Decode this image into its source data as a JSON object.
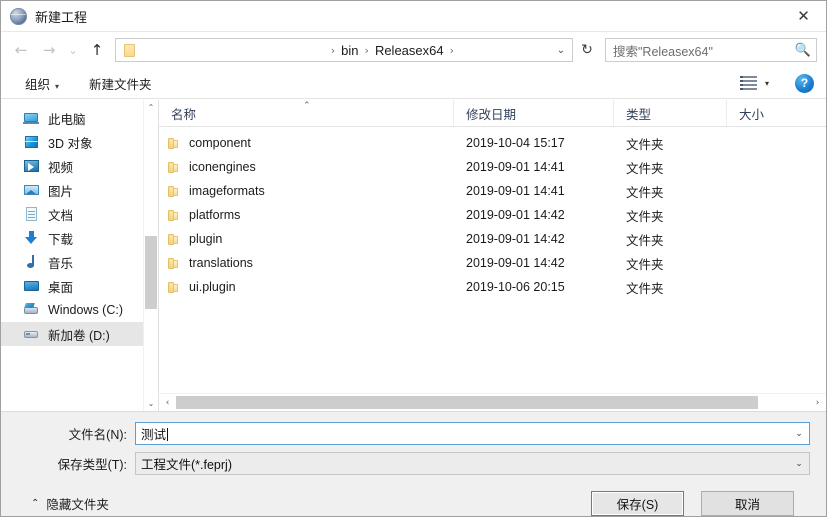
{
  "window": {
    "title": "新建工程",
    "icon": "globe-icon",
    "close_label": "✕"
  },
  "nav": {
    "back": "←",
    "forward": "→",
    "recent": "⌄",
    "up": "↑",
    "breadcrumbs": [
      "bin",
      "Releasex64"
    ],
    "separator": "›",
    "dropdown": "⌄",
    "refresh": "↻"
  },
  "search": {
    "placeholder": "搜索\"Releasex64\"",
    "icon": "search-icon"
  },
  "toolbar": {
    "organize_label": "组织",
    "organize_caret": "▾",
    "new_folder_label": "新建文件夹",
    "view_caret": "▾",
    "help_label": "?"
  },
  "sidebar": {
    "items": [
      {
        "label": "此电脑",
        "icon": "computer-icon",
        "selected": false
      },
      {
        "label": "3D 对象",
        "icon": "3d-objects-icon",
        "selected": false
      },
      {
        "label": "视频",
        "icon": "videos-icon",
        "selected": false
      },
      {
        "label": "图片",
        "icon": "pictures-icon",
        "selected": false
      },
      {
        "label": "文档",
        "icon": "documents-icon",
        "selected": false
      },
      {
        "label": "下载",
        "icon": "downloads-icon",
        "selected": false
      },
      {
        "label": "音乐",
        "icon": "music-icon",
        "selected": false
      },
      {
        "label": "桌面",
        "icon": "desktop-icon",
        "selected": false
      },
      {
        "label": "Windows (C:)",
        "icon": "drive-c-icon",
        "selected": false
      },
      {
        "label": "新加卷 (D:)",
        "icon": "drive-d-icon",
        "selected": true
      }
    ],
    "scroll_up": "⌃",
    "scroll_down": "⌄"
  },
  "filelist": {
    "columns": [
      "名称",
      "修改日期",
      "类型",
      "大小"
    ],
    "sort_indicator": "⌃",
    "rows": [
      {
        "name": "component",
        "date": "2019-10-04 15:17",
        "type": "文件夹",
        "size": ""
      },
      {
        "name": "iconengines",
        "date": "2019-09-01 14:41",
        "type": "文件夹",
        "size": ""
      },
      {
        "name": "imageformats",
        "date": "2019-09-01 14:41",
        "type": "文件夹",
        "size": ""
      },
      {
        "name": "platforms",
        "date": "2019-09-01 14:42",
        "type": "文件夹",
        "size": ""
      },
      {
        "name": "plugin",
        "date": "2019-09-01 14:42",
        "type": "文件夹",
        "size": ""
      },
      {
        "name": "translations",
        "date": "2019-09-01 14:42",
        "type": "文件夹",
        "size": ""
      },
      {
        "name": "ui.plugin",
        "date": "2019-10-06 20:15",
        "type": "文件夹",
        "size": ""
      }
    ],
    "hscroll_left": "‹",
    "hscroll_right": "›"
  },
  "form": {
    "filename_label": "文件名(N):",
    "filename_value": "测试",
    "filetype_label": "保存类型(T):",
    "filetype_value": "工程文件(*.feprj)",
    "dropdown_arrow": "⌄"
  },
  "footer": {
    "hide_folders_chevron": "⌃",
    "hide_folders_label": "隐藏文件夹",
    "save_label": "保存(S)",
    "cancel_label": "取消"
  }
}
